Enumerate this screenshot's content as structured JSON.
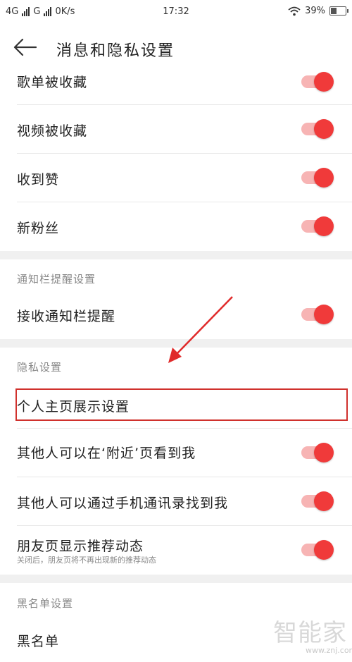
{
  "status_bar": {
    "network1": "4G",
    "network2": "G",
    "speed": "0K/s",
    "time": "17:32",
    "battery": "39%"
  },
  "header": {
    "title": "消息和隐私设置"
  },
  "rows": [
    {
      "label": "歌单被收藏",
      "on": true
    },
    {
      "label": "视频被收藏",
      "on": true
    },
    {
      "label": "收到赞",
      "on": true
    },
    {
      "label": "新粉丝",
      "on": true
    }
  ],
  "notification": {
    "section_title": "通知栏提醒设置",
    "row": {
      "label": "接收通知栏提醒",
      "on": true
    }
  },
  "privacy": {
    "section_title": "隐私设置",
    "profile_display": "个人主页展示设置",
    "nearby": {
      "label": "其他人可以在‘附近’页看到我",
      "on": true
    },
    "contacts": {
      "label": "其他人可以通过手机通讯录找到我",
      "on": true
    },
    "friends": {
      "label": "朋友页显示推荐动态",
      "desc": "关闭后，朋友页将不再出现新的推荐动态",
      "on": true
    }
  },
  "blacklist": {
    "section_title": "黑名单设置",
    "label": "黑名单"
  },
  "watermark": {
    "text": "智能家",
    "url": "www.znj.com"
  },
  "colors": {
    "accent": "#f03a3a",
    "track": "#f7b4b4",
    "annotation": "#d0312d"
  }
}
